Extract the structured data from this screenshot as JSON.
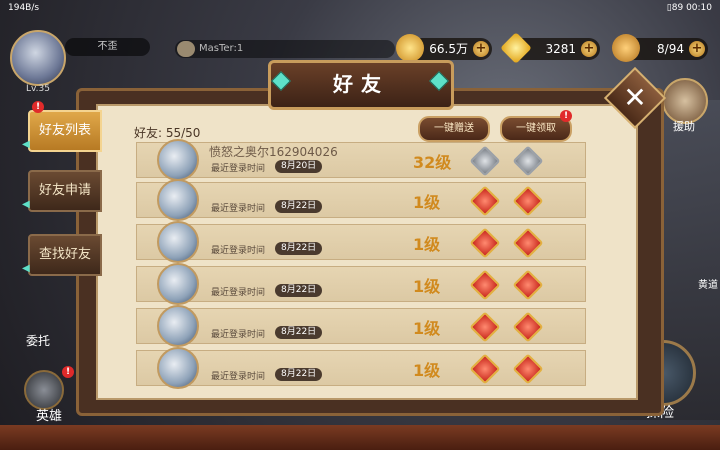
{
  "status_bar": {
    "network": "194B/s",
    "battery": "89",
    "time": "00:10"
  },
  "player": {
    "name": "不歪",
    "level": "Lv.35"
  },
  "chat": {
    "text": "MasTer:1"
  },
  "resources": [
    {
      "icon": "gold-coin-icon",
      "value": "66.5万"
    },
    {
      "icon": "diamond-icon",
      "value": "3281"
    },
    {
      "icon": "stamina-icon",
      "value": "8/94"
    }
  ],
  "panel": {
    "title": "好友",
    "friend_count": "好友: 55/50"
  },
  "buttons": {
    "send_all": "一键赠送",
    "claim_all": "一键领取"
  },
  "tabs": [
    {
      "label": "好友列表",
      "active": true
    },
    {
      "label": "好友申请",
      "active": false
    },
    {
      "label": "查找好友",
      "active": false
    }
  ],
  "rows": [
    {
      "name": "愤怒之奥尔162904026",
      "last_login_label": "最近登录时间",
      "date": "8月20日",
      "level": "32级",
      "gift_state": "grey"
    },
    {
      "name": "",
      "last_login_label": "最近登录时间",
      "date": "8月22日",
      "level": "1级",
      "gift_state": "red"
    },
    {
      "name": "",
      "last_login_label": "最近登录时间",
      "date": "8月22日",
      "level": "1级",
      "gift_state": "red"
    },
    {
      "name": "",
      "last_login_label": "最近登录时间",
      "date": "8月22日",
      "level": "1级",
      "gift_state": "red"
    },
    {
      "name": "",
      "last_login_label": "最近登录时间",
      "date": "8月22日",
      "level": "1级",
      "gift_state": "red"
    },
    {
      "name": "",
      "last_login_label": "最近登录时间",
      "date": "8月22日",
      "level": "1级",
      "gift_state": "red"
    }
  ],
  "side": {
    "help": "援助",
    "commission": "委托",
    "heroes": "英雄",
    "explore": "探险",
    "road": "黄道"
  },
  "colors": {
    "accent_gold": "#e0a84a",
    "level_text": "#d18a1e",
    "badge_red": "#e02a2a"
  }
}
